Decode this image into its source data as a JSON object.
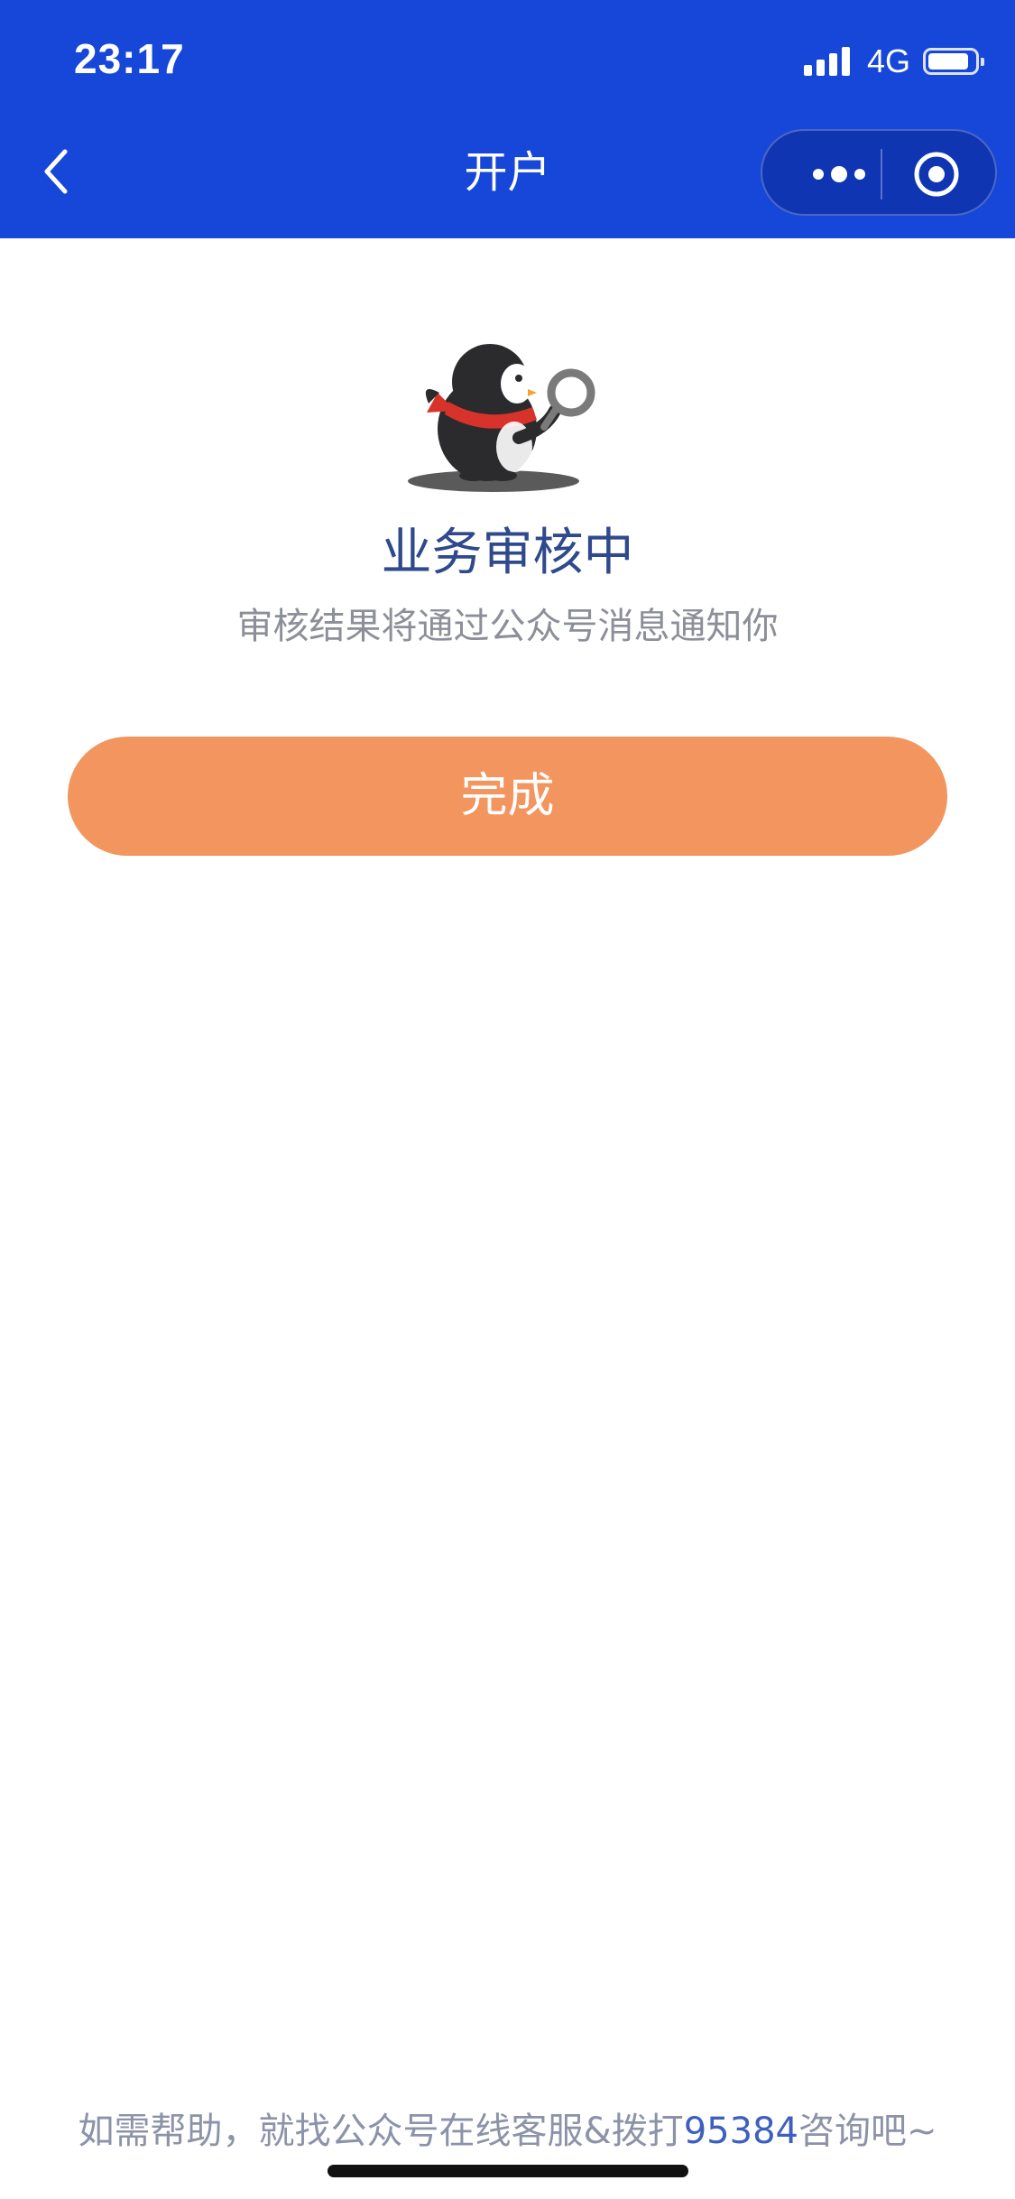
{
  "status_bar": {
    "time": "23:17",
    "network": "4G",
    "signal_icon": "signal-bars-icon",
    "battery_icon": "battery-icon"
  },
  "nav": {
    "title": "开户",
    "back_icon": "chevron-left-icon",
    "more_icon": "more-dots-icon",
    "close_icon": "target-close-icon"
  },
  "result": {
    "illustration": "penguin-magnifier-illustration",
    "title": "业务审核中",
    "description": "审核结果将通过公众号消息通知你"
  },
  "actions": {
    "done_label": "完成"
  },
  "footer": {
    "help_prefix": "如需帮助，就找公众号在线客服&拨打",
    "phone": "95384",
    "help_suffix": "咨询吧~"
  },
  "colors": {
    "header_bg": "#1747d8",
    "button_bg": "#f2955e",
    "title_text": "#2f4a8c",
    "link_text": "#3d5fc0"
  }
}
